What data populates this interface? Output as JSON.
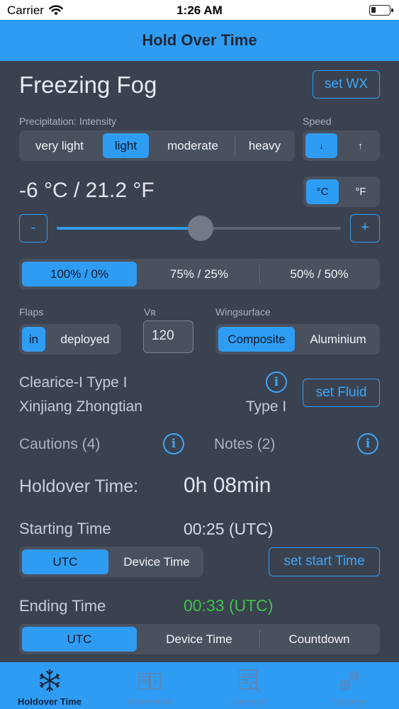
{
  "status_bar": {
    "carrier": "Carrier",
    "time": "1:26 AM"
  },
  "nav": {
    "title": "Hold Over Time"
  },
  "weather": {
    "condition": "Freezing Fog",
    "set_wx_label": "set WX"
  },
  "precipitation": {
    "label": "Precipitation: Intensity",
    "options": [
      "very light",
      "light",
      "moderate",
      "heavy"
    ],
    "selected": "light"
  },
  "speed": {
    "label": "Speed",
    "options": [
      "↓",
      "↑"
    ],
    "selected": "↓"
  },
  "temperature": {
    "display": "-6 °C / 21.2 °F",
    "unit_options": [
      "°C",
      "°F"
    ],
    "selected_unit": "°C",
    "minus_label": "-",
    "plus_label": "+",
    "slider_fraction": 0.505
  },
  "mix": {
    "options": [
      "100% / 0%",
      "75% / 25%",
      "50% / 50%"
    ],
    "selected": "100% / 0%"
  },
  "flaps": {
    "label": "Flaps",
    "options": [
      "in",
      "deployed"
    ],
    "selected": "in"
  },
  "vr": {
    "label": "Vʀ",
    "value": "120"
  },
  "wingsurface": {
    "label": "Wingsurface",
    "options": [
      "Composite",
      "Aluminium"
    ],
    "selected": "Composite"
  },
  "fluid": {
    "name": "Clearice-I Type I",
    "manufacturer": "Xinjiang Zhongtian",
    "type": "Type I",
    "set_fluid_label": "set Fluid"
  },
  "cautions": {
    "label": "Cautions (4)"
  },
  "notes": {
    "label": "Notes (2)"
  },
  "holdover": {
    "label": "Holdover Time:",
    "value": "0h 08min"
  },
  "starting": {
    "label": "Starting Time",
    "value": "00:25 (UTC)",
    "options": [
      "UTC",
      "Device Time"
    ],
    "selected": "UTC",
    "set_start_label": "set start Time"
  },
  "ending": {
    "label": "Ending Time",
    "value": "00:33 (UTC)",
    "value_color": "#3fc24a",
    "options": [
      "UTC",
      "Device Time",
      "Countdown"
    ],
    "selected": "UTC"
  },
  "tabs": [
    {
      "label": "Holdover Time",
      "icon": "snowflake-icon",
      "active": true
    },
    {
      "label": "Information",
      "icon": "book-icon",
      "active": false
    },
    {
      "label": "Decoder",
      "icon": "document-search-icon",
      "active": false
    },
    {
      "label": "Settings",
      "icon": "gears-icon",
      "active": false
    }
  ],
  "colors": {
    "accent": "#2f9cf4",
    "background": "#3a4250",
    "segment": "#4a515e",
    "ending_time": "#3fc24a"
  }
}
